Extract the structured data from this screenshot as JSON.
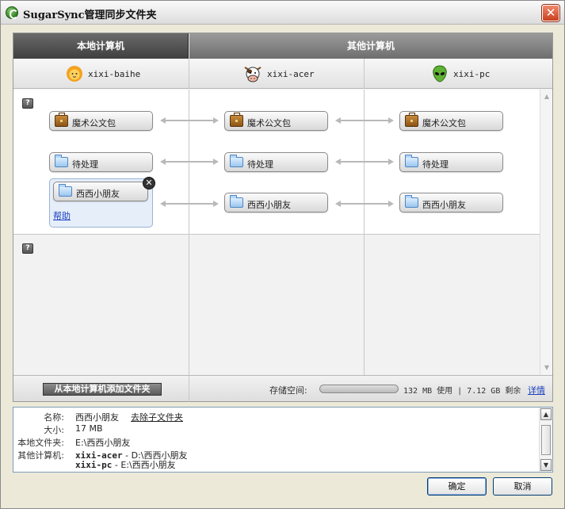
{
  "window": {
    "title": "SugarSync管理同步文件夹",
    "close_glyph": "✕"
  },
  "headers": {
    "local": "本地计算机",
    "other": "其他计算机"
  },
  "computers": [
    {
      "name": "xixi-baihe",
      "icon": "lion-avatar-icon"
    },
    {
      "name": "xixi-acer",
      "icon": "cow-avatar-icon"
    },
    {
      "name": "xixi-pc",
      "icon": "alien-avatar-icon"
    }
  ],
  "help_glyph": "?",
  "folders": {
    "row1": "魔术公文包",
    "row2": "待处理",
    "row3": "西西小朋友"
  },
  "help_link": "帮助",
  "remove_glyph": "✕",
  "bottom": {
    "add_button": "从本地计算机添加文件夹",
    "storage_label": "存储空间:",
    "storage_used_fraction": 0.02,
    "storage_used_text": "132 MB 使用 | 7.12 GB 剩余",
    "upgrade_link": "详情"
  },
  "info": {
    "name_label": "名称:",
    "name_value": "西西小朋友",
    "remove_link": "去除子文件夹",
    "size_label": "大小:",
    "size_value": "17 MB",
    "local_label": "本地文件夹:",
    "local_value": "E:\\西西小朋友",
    "other_label": "其他计算机:",
    "other_1_name": "xixi-acer",
    "other_1_path": " - D:\\西西小朋友",
    "other_2_name": "xixi-pc",
    "other_2_path": " - E:\\西西小朋友"
  },
  "buttons": {
    "ok": "确定",
    "cancel": "取消"
  },
  "scroll_glyphs": {
    "up": "▲",
    "down": "▼"
  },
  "colors": {
    "link": "#1a3fbf",
    "local_header": "#4a4a4a",
    "other_header": "#7e7e7e"
  }
}
